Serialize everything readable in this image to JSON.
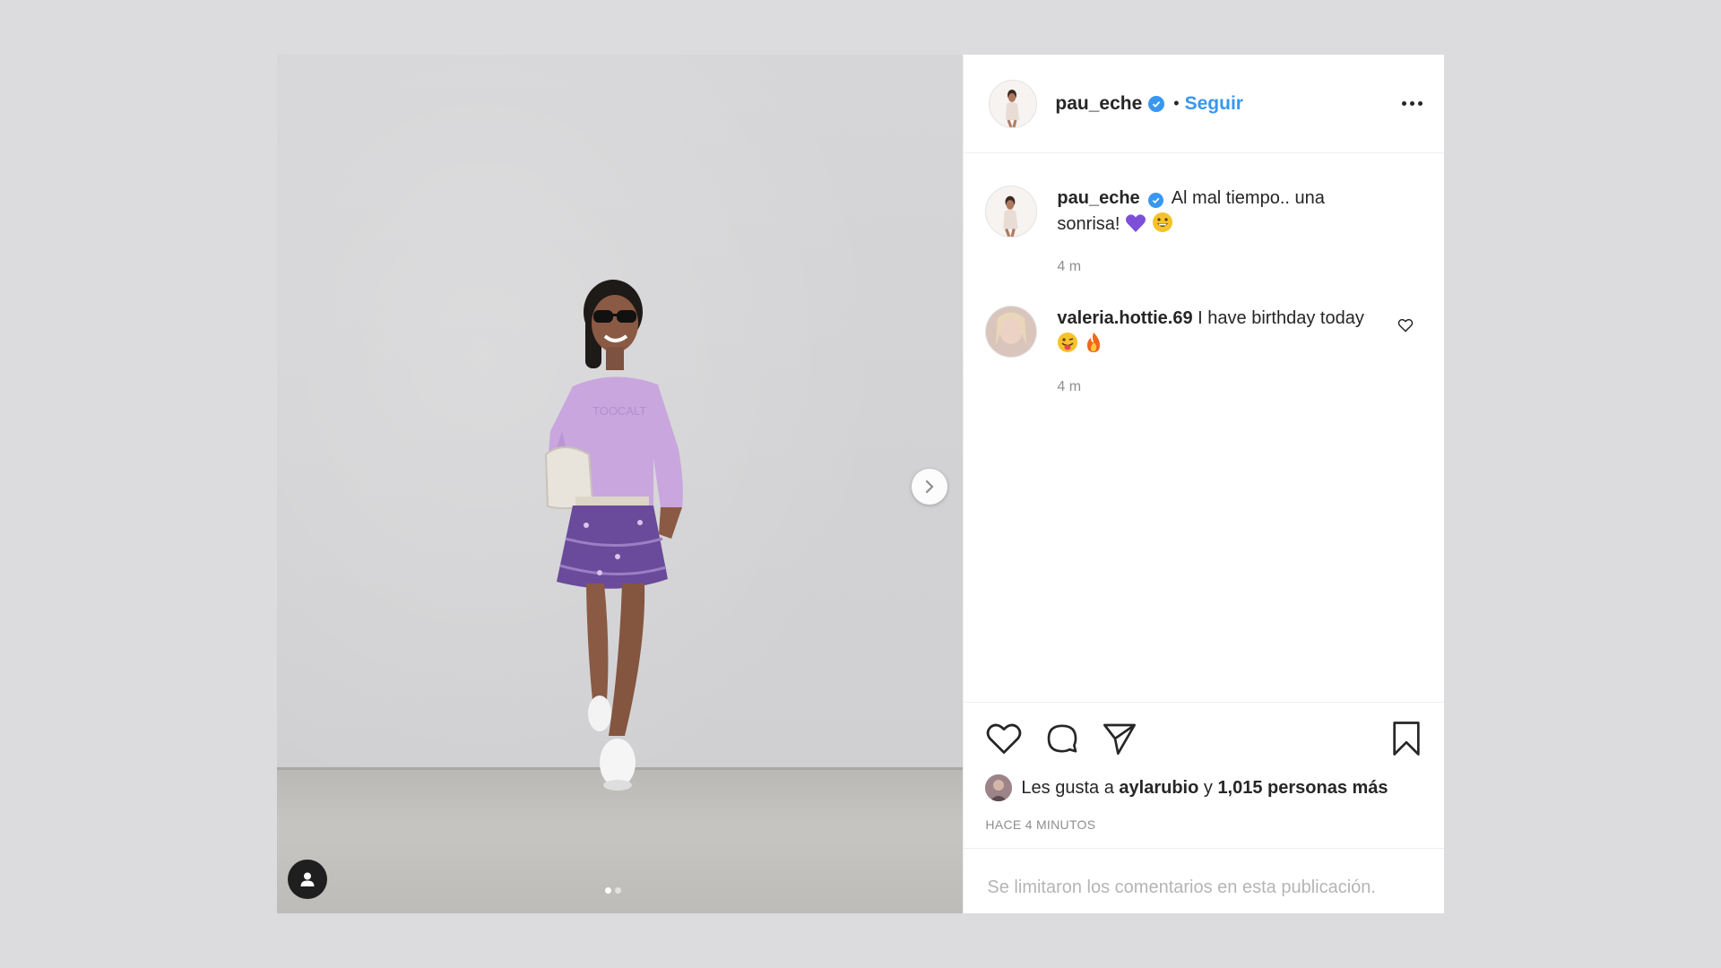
{
  "post": {
    "author": "pau_eche",
    "follow_label": "Seguir",
    "separator": "•",
    "caption_text": "Al mal tiempo.. una sonrisa!",
    "caption_time": "4 m",
    "comment": {
      "username": "valeria.hottie.69",
      "text": "I have birthday today",
      "time": "4 m"
    },
    "likes": {
      "prefix": "Les gusta a",
      "first_liker": "aylarubio",
      "conjunction": "y",
      "others": "1,015 personas más"
    },
    "timestamp": "HACE 4 MINUTOS",
    "comments_limited": "Se limitaron los comentarios en esta publicación.",
    "carousel": {
      "current_slide": 1,
      "total_slides": 2
    }
  },
  "icons": {
    "like": "heart-icon",
    "comment": "comment-icon",
    "share": "paper-plane-icon",
    "save": "bookmark-icon",
    "more": "more-options-icon",
    "next": "chevron-right-icon",
    "tag": "user-tag-icon",
    "verified": "verified-badge-icon"
  },
  "colors": {
    "accent": "#3897f0",
    "text": "#262626",
    "muted": "#8e8e8e",
    "background": "#dcdcde"
  }
}
